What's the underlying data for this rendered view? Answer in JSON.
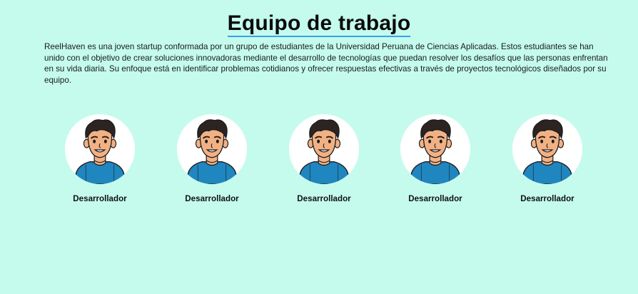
{
  "header": {
    "title": "Equipo de trabajo"
  },
  "intro": {
    "text": "ReelHaven es una joven startup conformada por un grupo de estudiantes de la Universidad Peruana de Ciencias Aplicadas. Estos estudiantes se han unido con el objetivo de crear soluciones innovadoras mediante el desarrollo de tecnologías que puedan resolver los desafíos que las personas enfrentan en su vida diaria. Su enfoque está en identificar problemas cotidianos y ofrecer respuestas efectivas a través de proyectos tecnológicos diseñados por su equipo."
  },
  "team": {
    "members": [
      {
        "role": "Desarrollador",
        "avatar_icon": "developer-avatar-icon"
      },
      {
        "role": "Desarrollador",
        "avatar_icon": "developer-avatar-icon"
      },
      {
        "role": "Desarrollador",
        "avatar_icon": "developer-avatar-icon"
      },
      {
        "role": "Desarrollador",
        "avatar_icon": "developer-avatar-icon"
      },
      {
        "role": "Desarrollador",
        "avatar_icon": "developer-avatar-icon"
      }
    ]
  },
  "colors": {
    "background": "#c4fbec",
    "title_underline": "#3aa0f0",
    "shirt": "#1f86bf",
    "skin": "#f2b184",
    "hair": "#2b2422"
  }
}
